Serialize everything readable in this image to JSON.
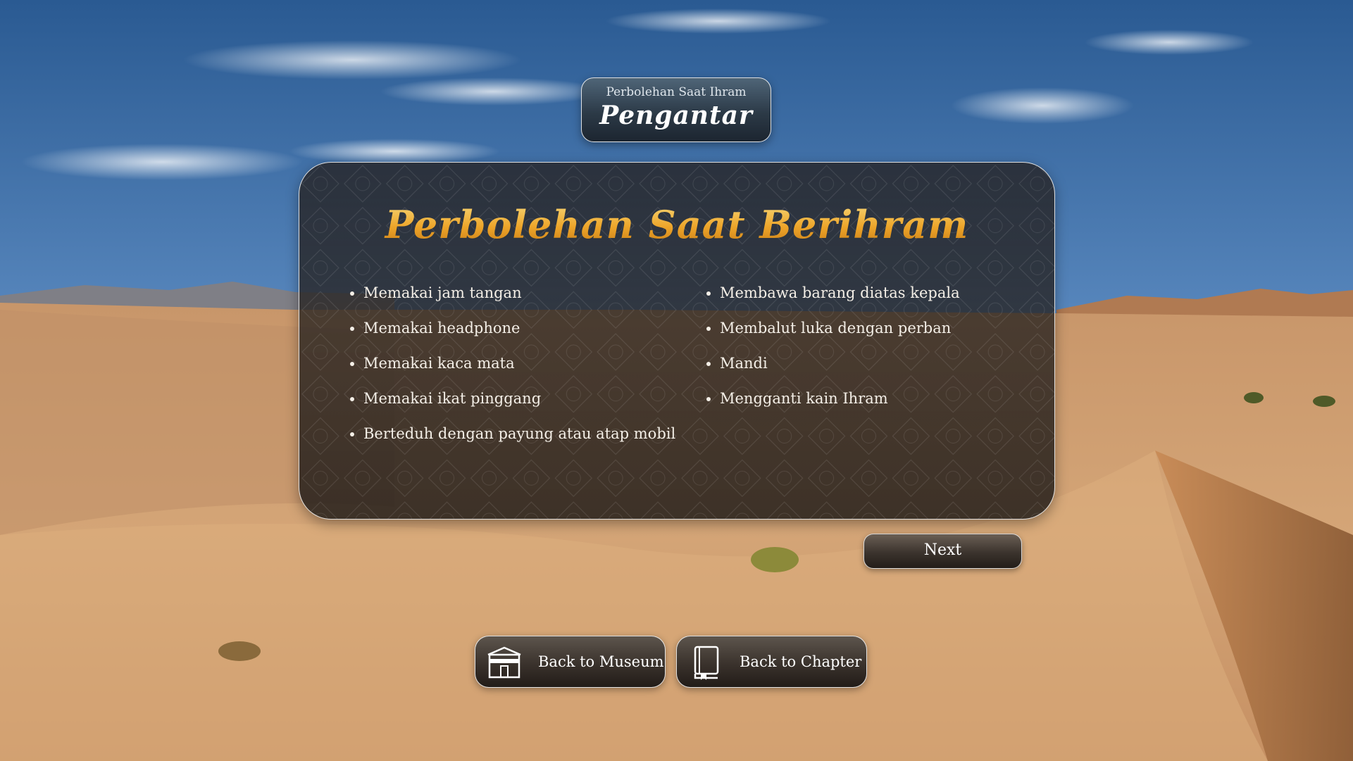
{
  "header": {
    "subtitle": "Perbolehan Saat Ihram",
    "title": "Pengantar"
  },
  "panel": {
    "title": "Perbolehan Saat Berihram",
    "left_items": [
      "Memakai jam tangan",
      "Memakai headphone",
      "Memakai kaca mata",
      "Memakai ikat pinggang",
      "Berteduh dengan payung atau atap mobil"
    ],
    "right_items": [
      "Membawa barang diatas kepala",
      "Membalut luka dengan perban",
      "Mandi",
      "Mengganti kain Ihram"
    ]
  },
  "buttons": {
    "next": "Next",
    "back_museum": "Back to Museum",
    "back_chapter": "Back to Chapter"
  },
  "icons": {
    "museum": "kaaba-icon",
    "chapter": "book-icon"
  },
  "colors": {
    "title_gold": "#f3b32f",
    "panel_bg": "#2a2624",
    "text": "#f4efe7"
  }
}
